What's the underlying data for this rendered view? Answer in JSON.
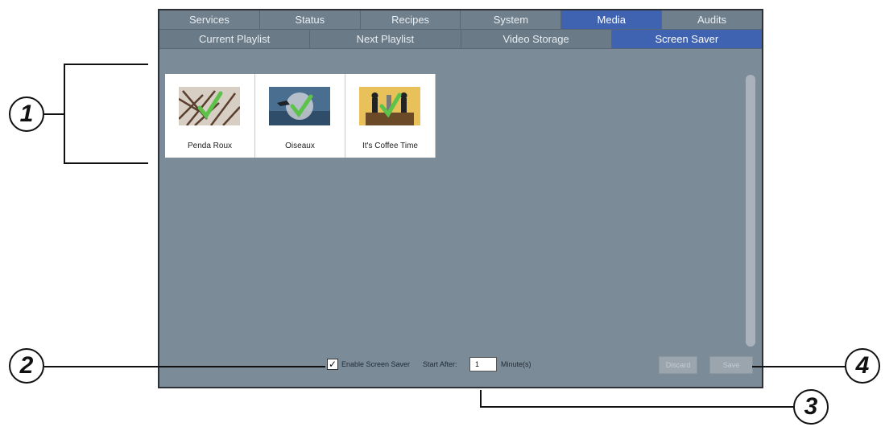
{
  "tabs": [
    "Services",
    "Status",
    "Recipes",
    "System",
    "Media",
    "Audits"
  ],
  "active_tab": "Media",
  "subtabs": [
    "Current Playlist",
    "Next Playlist",
    "Video Storage",
    "Screen Saver"
  ],
  "active_subtab": "Screen Saver",
  "screensavers": [
    {
      "label": "Penda Roux",
      "icon": "branches-image"
    },
    {
      "label": "Oiseaux",
      "icon": "bird-water-image"
    },
    {
      "label": "It's Coffee Time",
      "icon": "coffee-figures-image"
    }
  ],
  "enable_checked": "✓",
  "enable_label": "Enable Screen Saver",
  "start_after_label": "Start After:",
  "start_after_value": "1",
  "minutes_label": "Minute(s)",
  "discard_label": "Discard",
  "save_label": "Save",
  "callouts": [
    "1",
    "2",
    "3",
    "4"
  ],
  "colors": {
    "accent": "#3f63b0",
    "panel": "#7b8b98",
    "check": "#5cc24a"
  }
}
